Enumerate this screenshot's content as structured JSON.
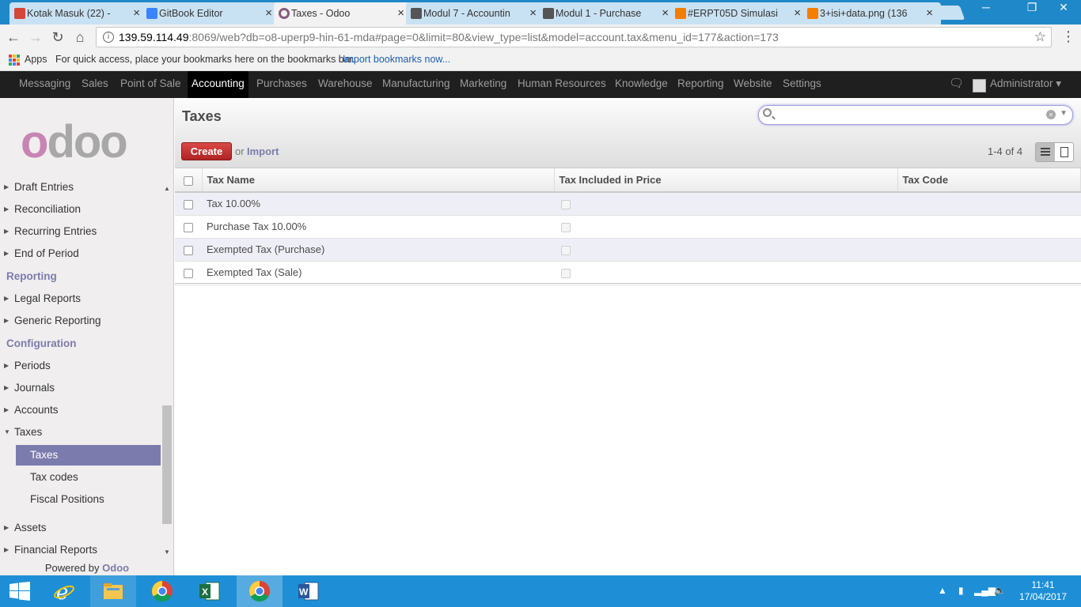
{
  "browser": {
    "tabs": [
      {
        "title": "Kotak Masuk (22) - ",
        "icon": "gmail-icon",
        "color": "#d44638"
      },
      {
        "title": "GitBook Editor",
        "icon": "gitbook-icon",
        "color": "#3884ff"
      },
      {
        "title": "Taxes - Odoo",
        "icon": "odoo-icon",
        "color": "#875a7b"
      },
      {
        "title": "Modul 7 - Accountin",
        "icon": "book-icon",
        "color": "#555555"
      },
      {
        "title": "Modul 1 - Purchase",
        "icon": "book-icon",
        "color": "#555555"
      },
      {
        "title": "#ERPT05D Simulasi",
        "icon": "blogger-icon",
        "color": "#f57d00"
      },
      {
        "title": "3+isi+data.png (136",
        "icon": "blogger-icon",
        "color": "#f57d00"
      }
    ],
    "url_host": "139.59.114.49",
    "url_rest": ":8069/web?db=o8-uperp9-hin-61-mda#page=0&limit=80&view_type=list&model=account.tax&menu_id=177&action=173",
    "bookmarks": {
      "apps_label": "Apps",
      "hint": "For quick access, place your bookmarks here on the bookmarks bar.",
      "import_link": "Import bookmarks now..."
    }
  },
  "topmenu": {
    "items": [
      "Messaging",
      "Sales",
      "Point of Sale",
      "Accounting",
      "Purchases",
      "Warehouse",
      "Manufacturing",
      "Marketing",
      "Human Resources",
      "Knowledge",
      "Reporting",
      "Website",
      "Settings"
    ],
    "active": "Accounting",
    "user": "Administrator"
  },
  "sidebar": {
    "logo_first": "o",
    "logo_rest": "doo",
    "items": [
      {
        "label": "Draft Entries",
        "kind": "item"
      },
      {
        "label": "Reconciliation",
        "kind": "item"
      },
      {
        "label": "Recurring Entries",
        "kind": "item"
      },
      {
        "label": "End of Period",
        "kind": "item"
      },
      {
        "label": "Reporting",
        "kind": "head"
      },
      {
        "label": "Legal Reports",
        "kind": "item"
      },
      {
        "label": "Generic Reporting",
        "kind": "item"
      },
      {
        "label": "Configuration",
        "kind": "head"
      },
      {
        "label": "Periods",
        "kind": "item"
      },
      {
        "label": "Journals",
        "kind": "item"
      },
      {
        "label": "Accounts",
        "kind": "item"
      },
      {
        "label": "Taxes",
        "kind": "open"
      },
      {
        "label": "Taxes",
        "kind": "active"
      },
      {
        "label": "Tax codes",
        "kind": "sub"
      },
      {
        "label": "Fiscal Positions",
        "kind": "sub"
      },
      {
        "label": "Assets",
        "kind": "item"
      },
      {
        "label": "Financial Reports",
        "kind": "item"
      }
    ],
    "powered_by": "Powered by",
    "powered_brand": "Odoo"
  },
  "control_panel": {
    "title": "Taxes",
    "create_label": "Create",
    "or_label": "or",
    "import_label": "Import",
    "pager": "1-4 of 4"
  },
  "table": {
    "columns": [
      "Tax Name",
      "Tax Included in Price",
      "Tax Code"
    ],
    "rows": [
      {
        "name": "Tax 10.00%",
        "included": false,
        "code": ""
      },
      {
        "name": "Purchase Tax 10.00%",
        "included": false,
        "code": ""
      },
      {
        "name": "Exempted Tax (Purchase)",
        "included": false,
        "code": ""
      },
      {
        "name": "Exempted Tax (Sale)",
        "included": false,
        "code": ""
      }
    ]
  },
  "taskbar": {
    "apps": [
      "windows-start-icon",
      "internet-explorer-icon",
      "file-explorer-icon",
      "chrome-icon",
      "excel-icon",
      "chrome-icon",
      "word-icon"
    ],
    "time": "11:41",
    "date": "17/04/2017"
  },
  "colors": {
    "odoo_purple": "#7c7bad",
    "create_red": "#c0302d",
    "topmenu_bg": "#1f1f1f",
    "taskbar_blue": "#1e8fd6"
  }
}
